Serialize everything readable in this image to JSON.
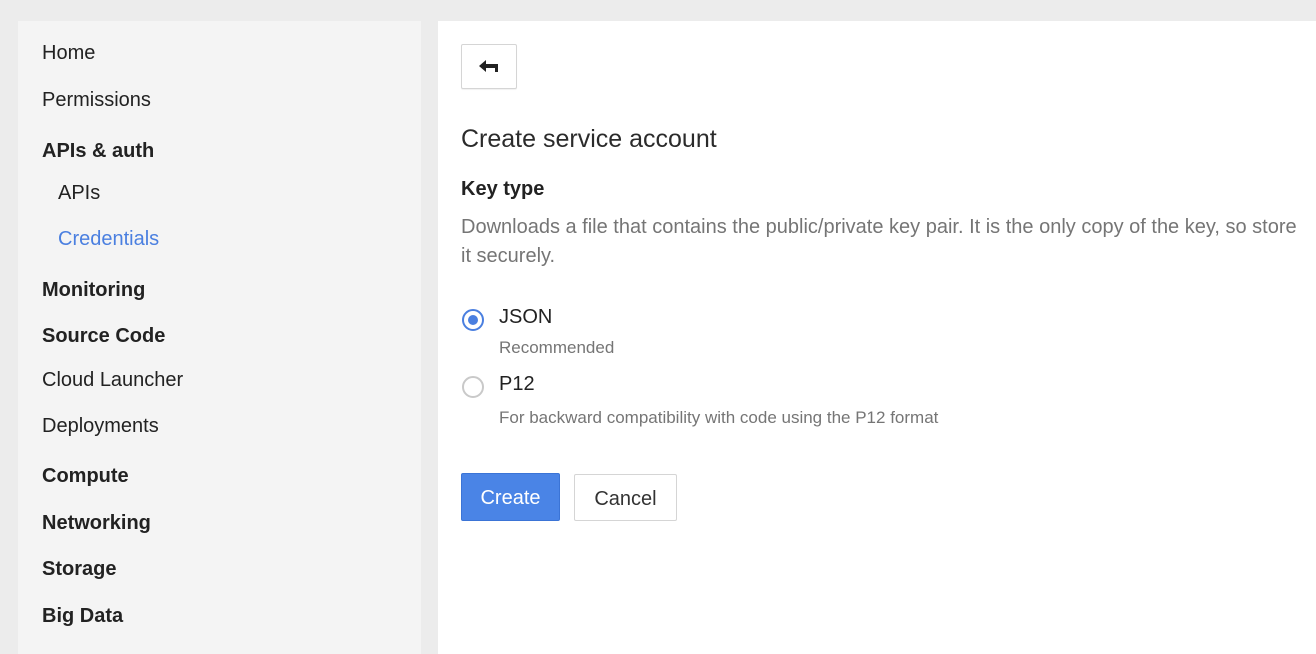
{
  "sidebar": {
    "items": [
      {
        "label": "Home"
      },
      {
        "label": "Permissions"
      },
      {
        "label": "APIs & auth"
      },
      {
        "label": "APIs"
      },
      {
        "label": "Credentials"
      },
      {
        "label": "Monitoring"
      },
      {
        "label": "Source Code"
      },
      {
        "label": "Cloud Launcher"
      },
      {
        "label": "Deployments"
      },
      {
        "label": "Compute"
      },
      {
        "label": "Networking"
      },
      {
        "label": "Storage"
      },
      {
        "label": "Big Data"
      }
    ],
    "active_item": "Credentials"
  },
  "main": {
    "back_icon": "back-arrow-icon",
    "title": "Create service account",
    "key_type": {
      "heading": "Key type",
      "description": "Downloads a file that contains the public/private key pair. It is the only copy of the key, so store it securely.",
      "selected": "JSON",
      "options": [
        {
          "label": "JSON",
          "help": "Recommended"
        },
        {
          "label": "P12",
          "help": "For backward compatibility with code using the P12 format"
        }
      ]
    },
    "actions": {
      "create_label": "Create",
      "cancel_label": "Cancel"
    }
  },
  "colors": {
    "accent": "#4a7fe0",
    "primary_button": "#4a84e6",
    "sidebar_bg": "#f4f4f4",
    "page_bg": "#ececec"
  }
}
